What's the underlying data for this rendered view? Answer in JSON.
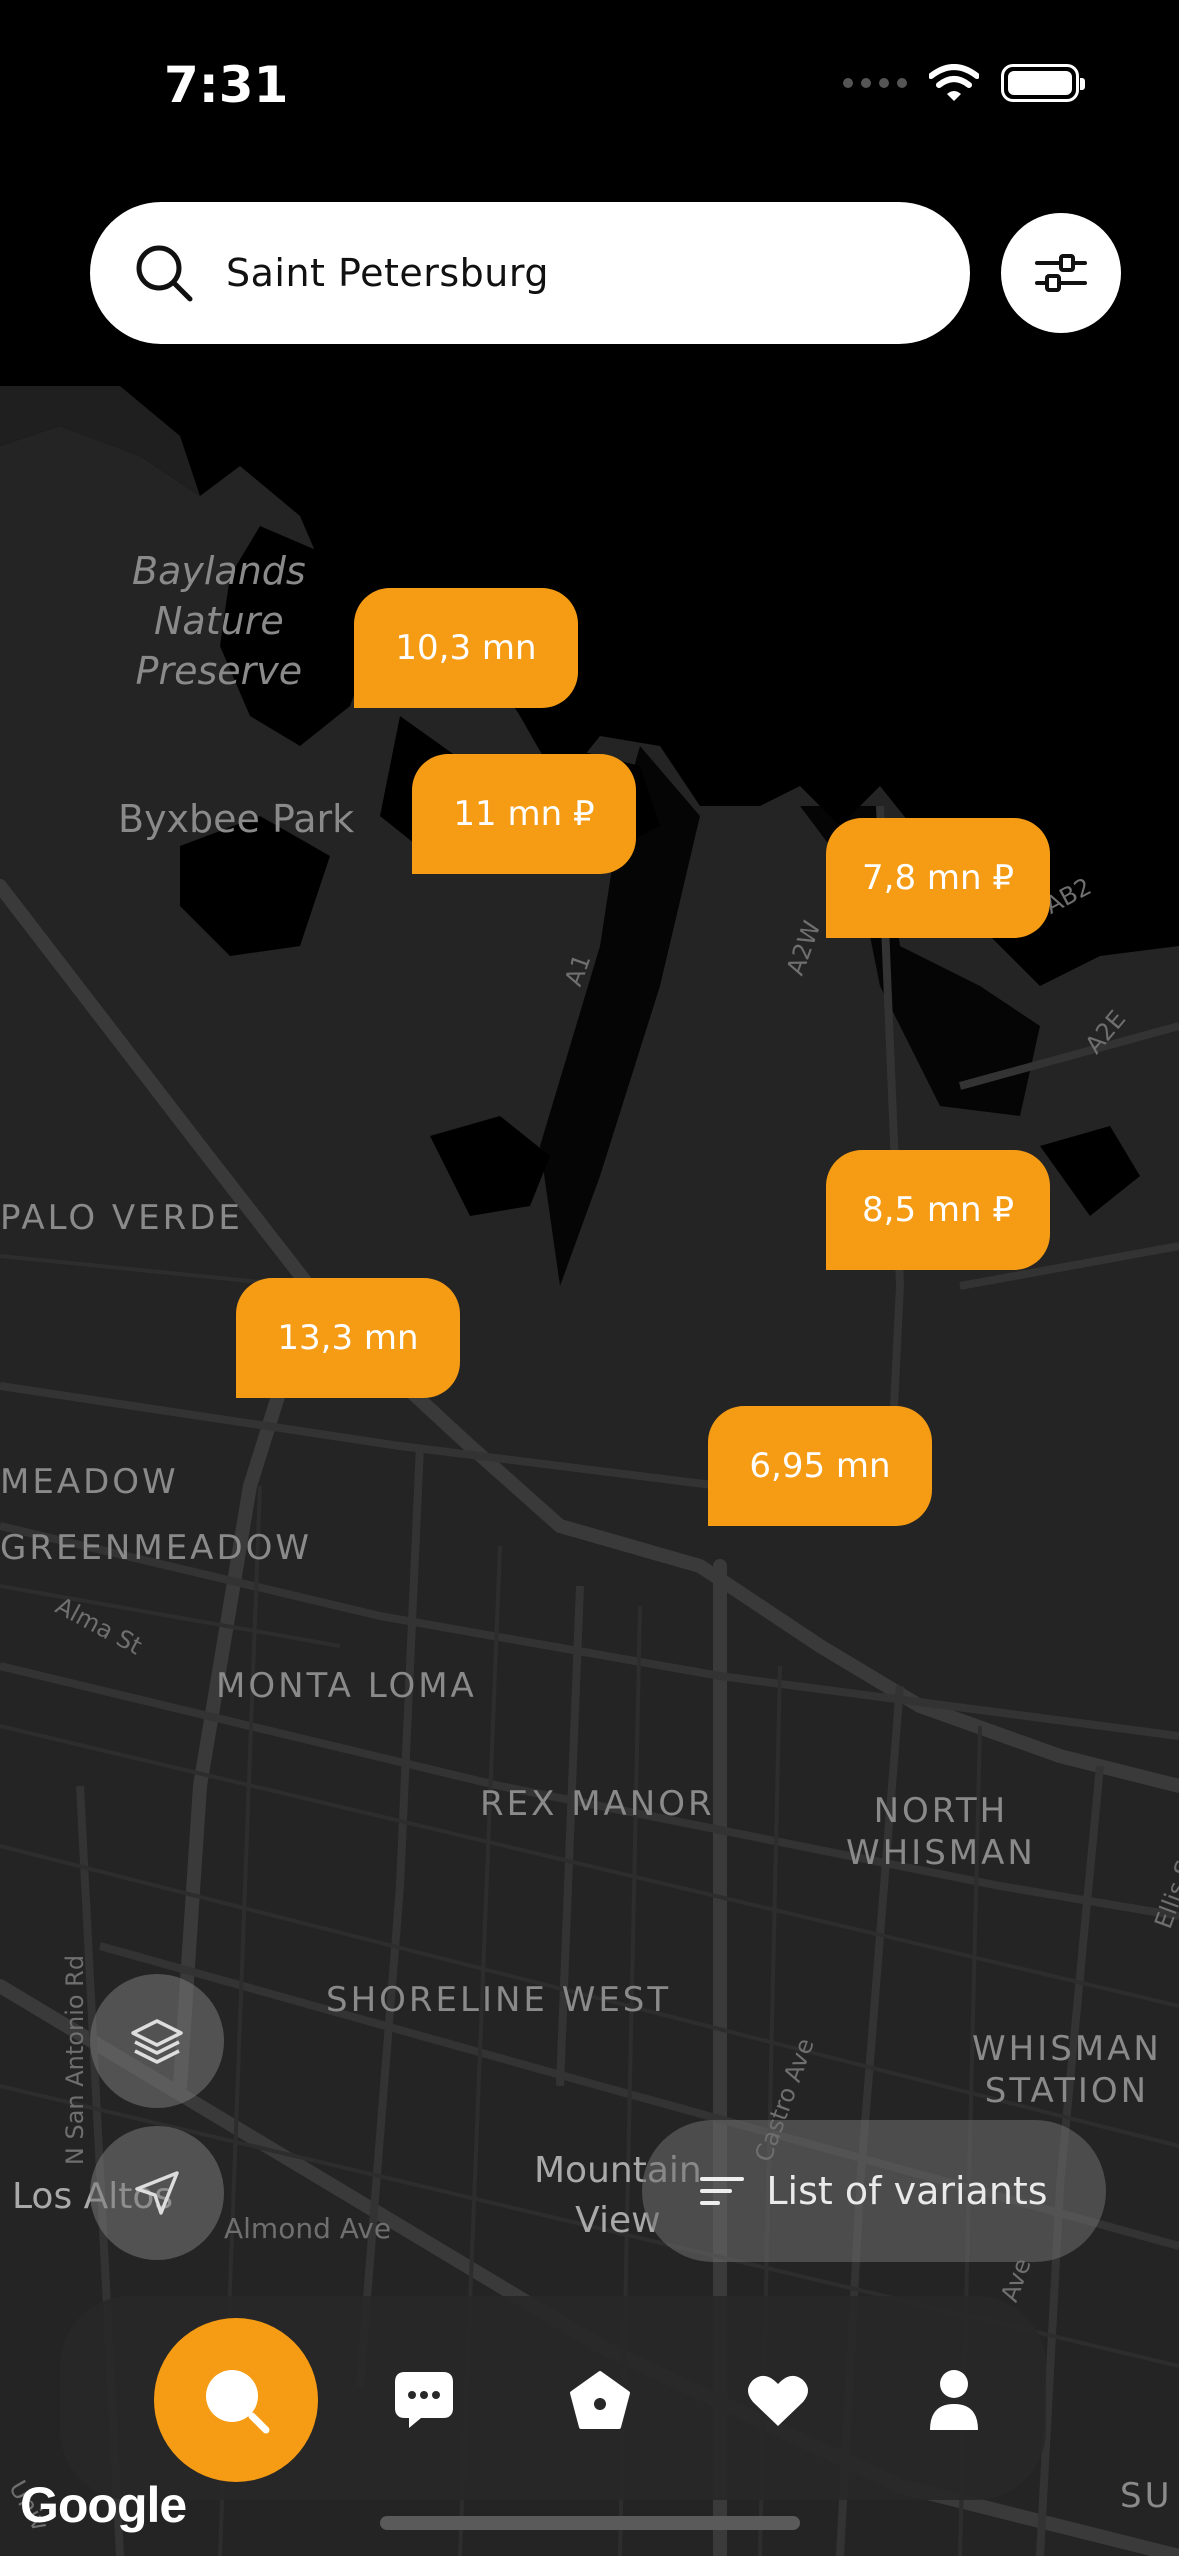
{
  "status_bar": {
    "time": "7:31"
  },
  "search": {
    "value": "Saint Petersburg",
    "icon": "search-icon"
  },
  "filter": {
    "icon": "sliders-icon"
  },
  "map": {
    "labels": {
      "baylands": "Baylands\nNature\nPreserve",
      "byxbee": "Byxbee Park",
      "palo_verde": "PALO VERDE",
      "meadow": "MEADOW",
      "greenmeadow": "GREENMEADOW",
      "alma": "Alma St",
      "monta_loma": "MONTA LOMA",
      "rex_manor": "REX MANOR",
      "north_whisman": "NORTH\nWHISMAN",
      "shoreline_west": "SHORELINE WEST",
      "whisman_station": "WHISMAN\nSTATION",
      "mountain_view": "Mountain\nView",
      "los_altos": "Los Altos",
      "almond": "Almond Ave",
      "san_antonio": "N San Antonio Rd",
      "a1": "A1",
      "a2w": "A2W",
      "ab2": "AB2",
      "a2e": "A2E",
      "ellis": "Ellis St",
      "castro": "Castro Ave",
      "sunset": "SU",
      "ave": "Ave",
      "univ": "Univ"
    },
    "attribution": "Google"
  },
  "pins": [
    {
      "label": "10,3 mn"
    },
    {
      "label": "11 mn ₽"
    },
    {
      "label": "7,8 mn ₽"
    },
    {
      "label": "8,5 mn ₽"
    },
    {
      "label": "13,3 mn"
    },
    {
      "label": "6,95 mn"
    }
  ],
  "controls": {
    "layers_icon": "layers-icon",
    "locate_icon": "navigation-arrow-icon",
    "list_button": "List of variants"
  },
  "tabbar": {
    "items": [
      "search",
      "messages",
      "home",
      "favorites",
      "profile"
    ]
  },
  "colors": {
    "accent": "#f59b14",
    "background": "#000000",
    "map_land": "#222222"
  }
}
